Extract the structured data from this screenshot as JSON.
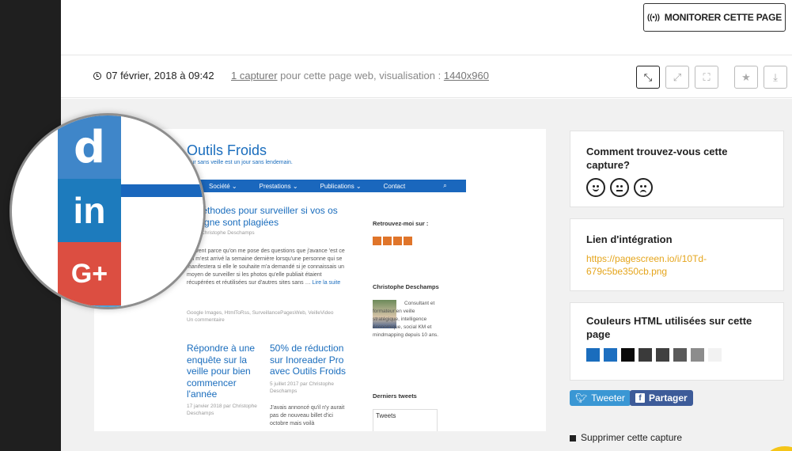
{
  "header": {
    "monitor_label": "MONITORER CETTE PAGE"
  },
  "capture_info": {
    "date": "07 février, 2018 à 09:42",
    "capture_link": "1 capturer",
    "text_mid": " pour cette page web, visualisation : ",
    "resolution": "1440x960"
  },
  "toolbar": {
    "icons": [
      "fullscreen-exit-icon",
      "expand-icon",
      "fullscreen-icon",
      "star-icon",
      "download-icon"
    ]
  },
  "screenshot": {
    "site_title": "Outils Froids",
    "tagline": "jour sans veille est un jour sans lendemain.",
    "nav": [
      "Société ⌄",
      "Prestations ⌄",
      "Publications ⌄",
      "Contact",
      "⌕"
    ],
    "article1_title": "x méthodes pour surveiller si vos os en ligne sont plagiées",
    "article1_meta": "18 ou Christophe Deschamps",
    "article1_body": "souvent parce qu'on me pose des questions que j'avance 'est ce qui m'est arrivé la semaine dernière lorsqu'une personne qui se manifestera si elle le souhaite m'a demandé si je connaissais un moyen de surveiller si les photos qu'elle publiait étaient récupérées et réutilisées sur d'autres sites sans …",
    "article1_more": "Lire la suite",
    "tags_line": "Google Images, HtmlToRss, SurveillancePagesWeb, VeilleVideo",
    "comment_line": "Un commentaire",
    "article2_title": "Répondre à une enquête sur la veille pour bien commencer l'année",
    "article2_meta": "17 janvier 2018 par Christophe Deschamps",
    "article3_title": "50% de réduction sur Inoreader Pro avec Outils Froids",
    "article3_meta": "5 juillet 2017 par Christophe Deschamps",
    "article3_body": "J'avais annoncé qu'il n'y aurait pas de nouveau billet d'ici octobre mais voilà",
    "side_follow": "Retrouvez-moi sur :",
    "side_author": "Christophe Deschamps",
    "side_bio": "Consultant et formateur en veille stratégique, intelligence économique, social KM et mindmapping depuis 10 ans.",
    "side_tweets": "Derniers tweets",
    "tweets_box": "Tweets"
  },
  "magnifier": {
    "tiles": [
      "d",
      "in",
      "G+"
    ]
  },
  "sidebar": {
    "feedback_title": "Comment trouvez-vous cette capture?",
    "faces": [
      "happy-face-icon",
      "neutral-face-icon",
      "sad-face-icon"
    ],
    "embed_title": "Lien d'intégration",
    "embed_link": "https://pagescreen.io/i/10Td-679c5be350cb.png",
    "colors_title": "Couleurs HTML utilisées sur cette page",
    "colors": [
      "#1a6dbd",
      "#1d6fc0",
      "#0a0a0a",
      "#3a3a3a",
      "#404040",
      "#5a5a5a",
      "#8c8c8c",
      "#f2f2f2"
    ],
    "tweet_label": "Tweeter",
    "share_label": "Partager",
    "delete_label": "Supprimer cette capture"
  }
}
